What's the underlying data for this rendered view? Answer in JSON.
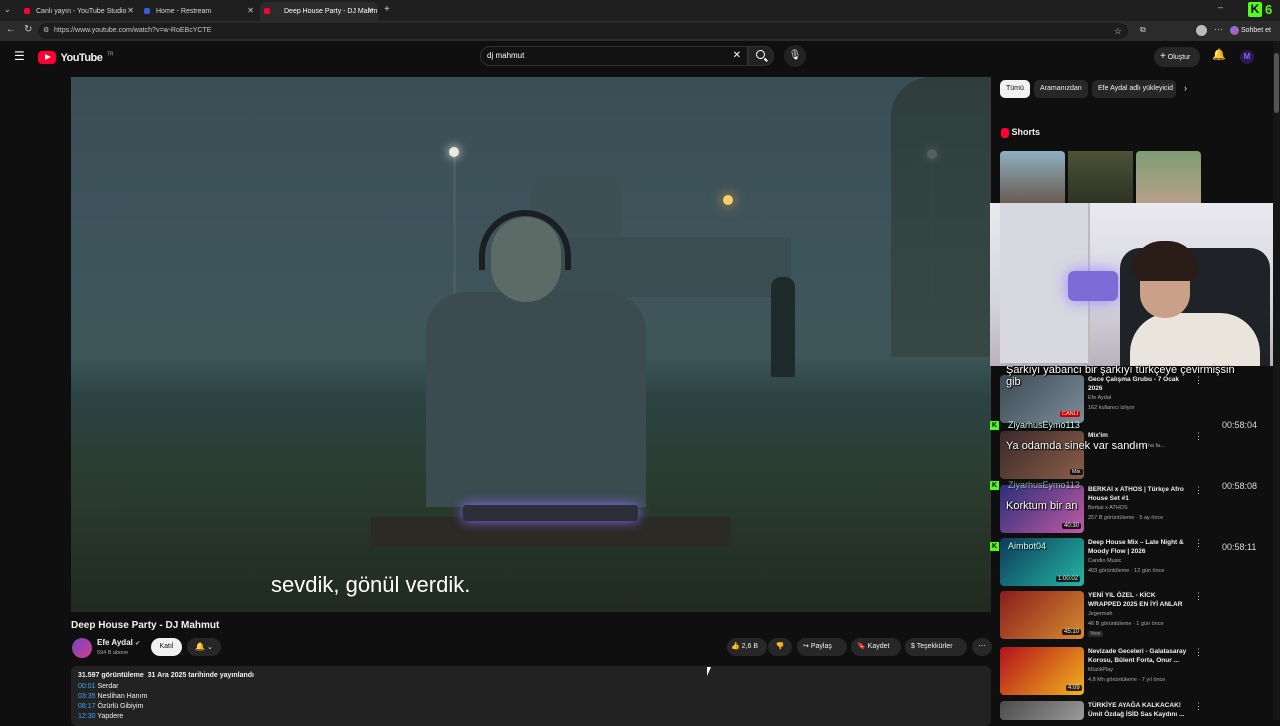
{
  "browser": {
    "tabs": [
      {
        "title": "Canlı yayın - YouTube Studio",
        "active": false
      },
      {
        "title": "Home - Restream",
        "active": false
      },
      {
        "title": "Deep House Party - DJ Mahm",
        "active": true
      }
    ],
    "url": "https://www.youtube.com/watch?v=w-RoEBcYCTE",
    "chat_button": "Sohbet et",
    "counter": "6"
  },
  "youtube": {
    "logo": "YouTube",
    "logo_suffix": "TR",
    "search_value": "dj mahmut",
    "create_label": "Oluştur"
  },
  "player": {
    "subtitle": "sevdik, gönül verdik."
  },
  "video": {
    "title": "Deep House Party - DJ Mahmut",
    "channel": "Efe Aydal",
    "subscribers": "594 B abone",
    "join_label": "Katıl",
    "likes": "2,6 B",
    "share_label": "Paylaş",
    "save_label": "Kaydet",
    "thanks_label": "Teşekkürler",
    "views_line": "31.597 görüntüleme  31 Ara 2025 tarihinde yayınlandı",
    "chapters": [
      {
        "time": "00:01",
        "name": "Serdar"
      },
      {
        "time": "03:35",
        "name": "Neslihan Hanım"
      },
      {
        "time": "08:17",
        "name": "Özürlü Gibiyim"
      },
      {
        "time": "12:30",
        "name": "Yapdere"
      }
    ]
  },
  "filters": [
    "Tümü",
    "Aramanızdan",
    "Efe Aydal adlı yükleyicid"
  ],
  "shorts_title": "Shorts",
  "related": [
    {
      "title": "Gece Çalışma Grubu - 7 Ocak 2026",
      "channel": "Efe Aydal",
      "meta": "162 kullanıcı izliyor",
      "badge": "CANLI",
      "duration": ""
    },
    {
      "title": "Mix'im",
      "channel": "",
      "meta": "ar ve daha fa...",
      "badge": "Mix",
      "duration": ""
    },
    {
      "title": "BERKAI x ATHOS | Türkçe Afro House Set #1",
      "channel": "Berkai x ATHOS",
      "meta": "257 B görüntüleme · 5 ay önce",
      "badge": "",
      "duration": "40:30"
    },
    {
      "title": "Deep House Mix – Late Night & Moody Flow | 2026",
      "channel": "Candio Music",
      "meta": "403 görüntüleme · 12 gün önce",
      "badge": "",
      "duration": "1:00:02"
    },
    {
      "title": "YENİ YIL ÖZEL - KİCK WRAPPED 2025 EN İYİ ANLAR",
      "channel": "Jegermah",
      "meta": "46 B görüntüleme · 1 gün önce",
      "badge": "Yeni",
      "duration": "45:10"
    },
    {
      "title": "Nevizade Geceleri - Galatasaray Korosu, Bülent Forta, Onur ...",
      "channel": "MüzikPlay",
      "meta": "4,8 Mn görüntüleme · 7 yıl önce",
      "badge": "",
      "duration": "4:09"
    },
    {
      "title": "TÜRKİYE AYAĞA KALKACAK! Ümit Özdağ İSİD Sas Kaydını ...",
      "channel": "",
      "meta": "",
      "badge": "",
      "duration": ""
    }
  ],
  "stream_chat": [
    {
      "user": "",
      "text": "Şarkıyı yabancı bir şarkıyı türkçeye çevirmişsin gib",
      "time": ""
    },
    {
      "user": "ZiyarhusEymo113",
      "text": "Ya odamda sinek var sandım",
      "time": "00:58:04"
    },
    {
      "user": "ZiyarhusEymo113",
      "text": "Korktum bir an",
      "time": "00:58:08"
    },
    {
      "user": "Aimbot04",
      "text": "",
      "time": "00:58:11"
    }
  ],
  "colors": {
    "yt_red": "#ff0033",
    "kick_green": "#53fc18",
    "bg": "#0f0f0f"
  }
}
